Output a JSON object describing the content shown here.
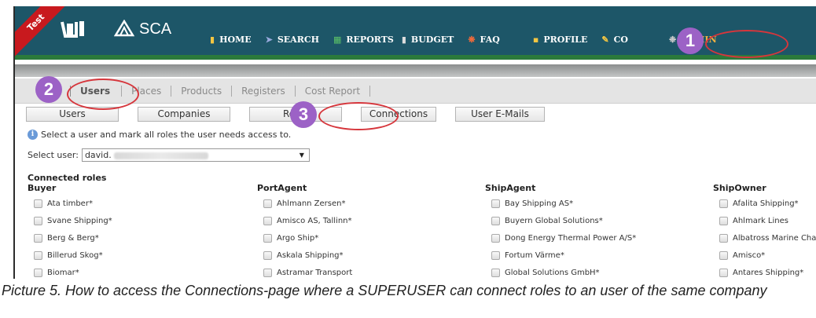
{
  "header": {
    "ribbon": "Test",
    "brand": "SCA",
    "nav": [
      {
        "label": "HOME",
        "icon": "home-icon"
      },
      {
        "label": "SEARCH",
        "icon": "search-icon"
      },
      {
        "label": "REPORTS",
        "icon": "reports-icon"
      },
      {
        "label": "BUDGET",
        "icon": "budget-icon"
      },
      {
        "label": "FAQ",
        "icon": "faq-icon"
      },
      {
        "label": "PROFILE",
        "icon": "profile-icon"
      },
      {
        "label": "CO",
        "icon": "contact-icon"
      },
      {
        "label": "ADMIN",
        "icon": "gear-icon"
      }
    ]
  },
  "subtabs": [
    "Users",
    "Places",
    "Products",
    "Registers",
    "Cost Report"
  ],
  "buttons": [
    "Users",
    "Companies",
    "Roles",
    "Connections",
    "User E-Mails"
  ],
  "info_text": "Select a user and mark all roles the user needs access to.",
  "select_user": {
    "label": "Select user:",
    "value": "david."
  },
  "connected_roles_title": "Connected roles",
  "columns": [
    {
      "heading": "Buyer",
      "items": [
        "Ata timber*",
        "Svane Shipping*",
        "Berg & Berg*",
        "Billerud Skog*",
        "Biomar*"
      ]
    },
    {
      "heading": "PortAgent",
      "items": [
        "Ahlmann Zersen*",
        "Amisco AS, Tallinn*",
        "Argo Ship*",
        "Askala Shipping*",
        "Astramar Transport"
      ]
    },
    {
      "heading": "ShipAgent",
      "items": [
        "Bay Shipping AS*",
        "Buyern Global Solutions*",
        "Dong Energy Thermal Power A/S*",
        "Fortum Värme*",
        "Global Solutions GmbH*"
      ]
    },
    {
      "heading": "ShipOwner",
      "items": [
        "Afalita Shipping*",
        "Ahlmark Lines",
        "Albatross Marine Cha",
        "Amisco*",
        "Antares Shipping*"
      ]
    }
  ],
  "annotations": [
    "1",
    "2",
    "3"
  ],
  "caption": "Picture 5. How to access the Connections-page where a SUPERUSER can connect roles to an user of the same company",
  "colors": {
    "header": "#1d5668",
    "accent_bar": "#2b7a3b",
    "annotation": "#9c62c6",
    "highlight": "#d6363c"
  }
}
